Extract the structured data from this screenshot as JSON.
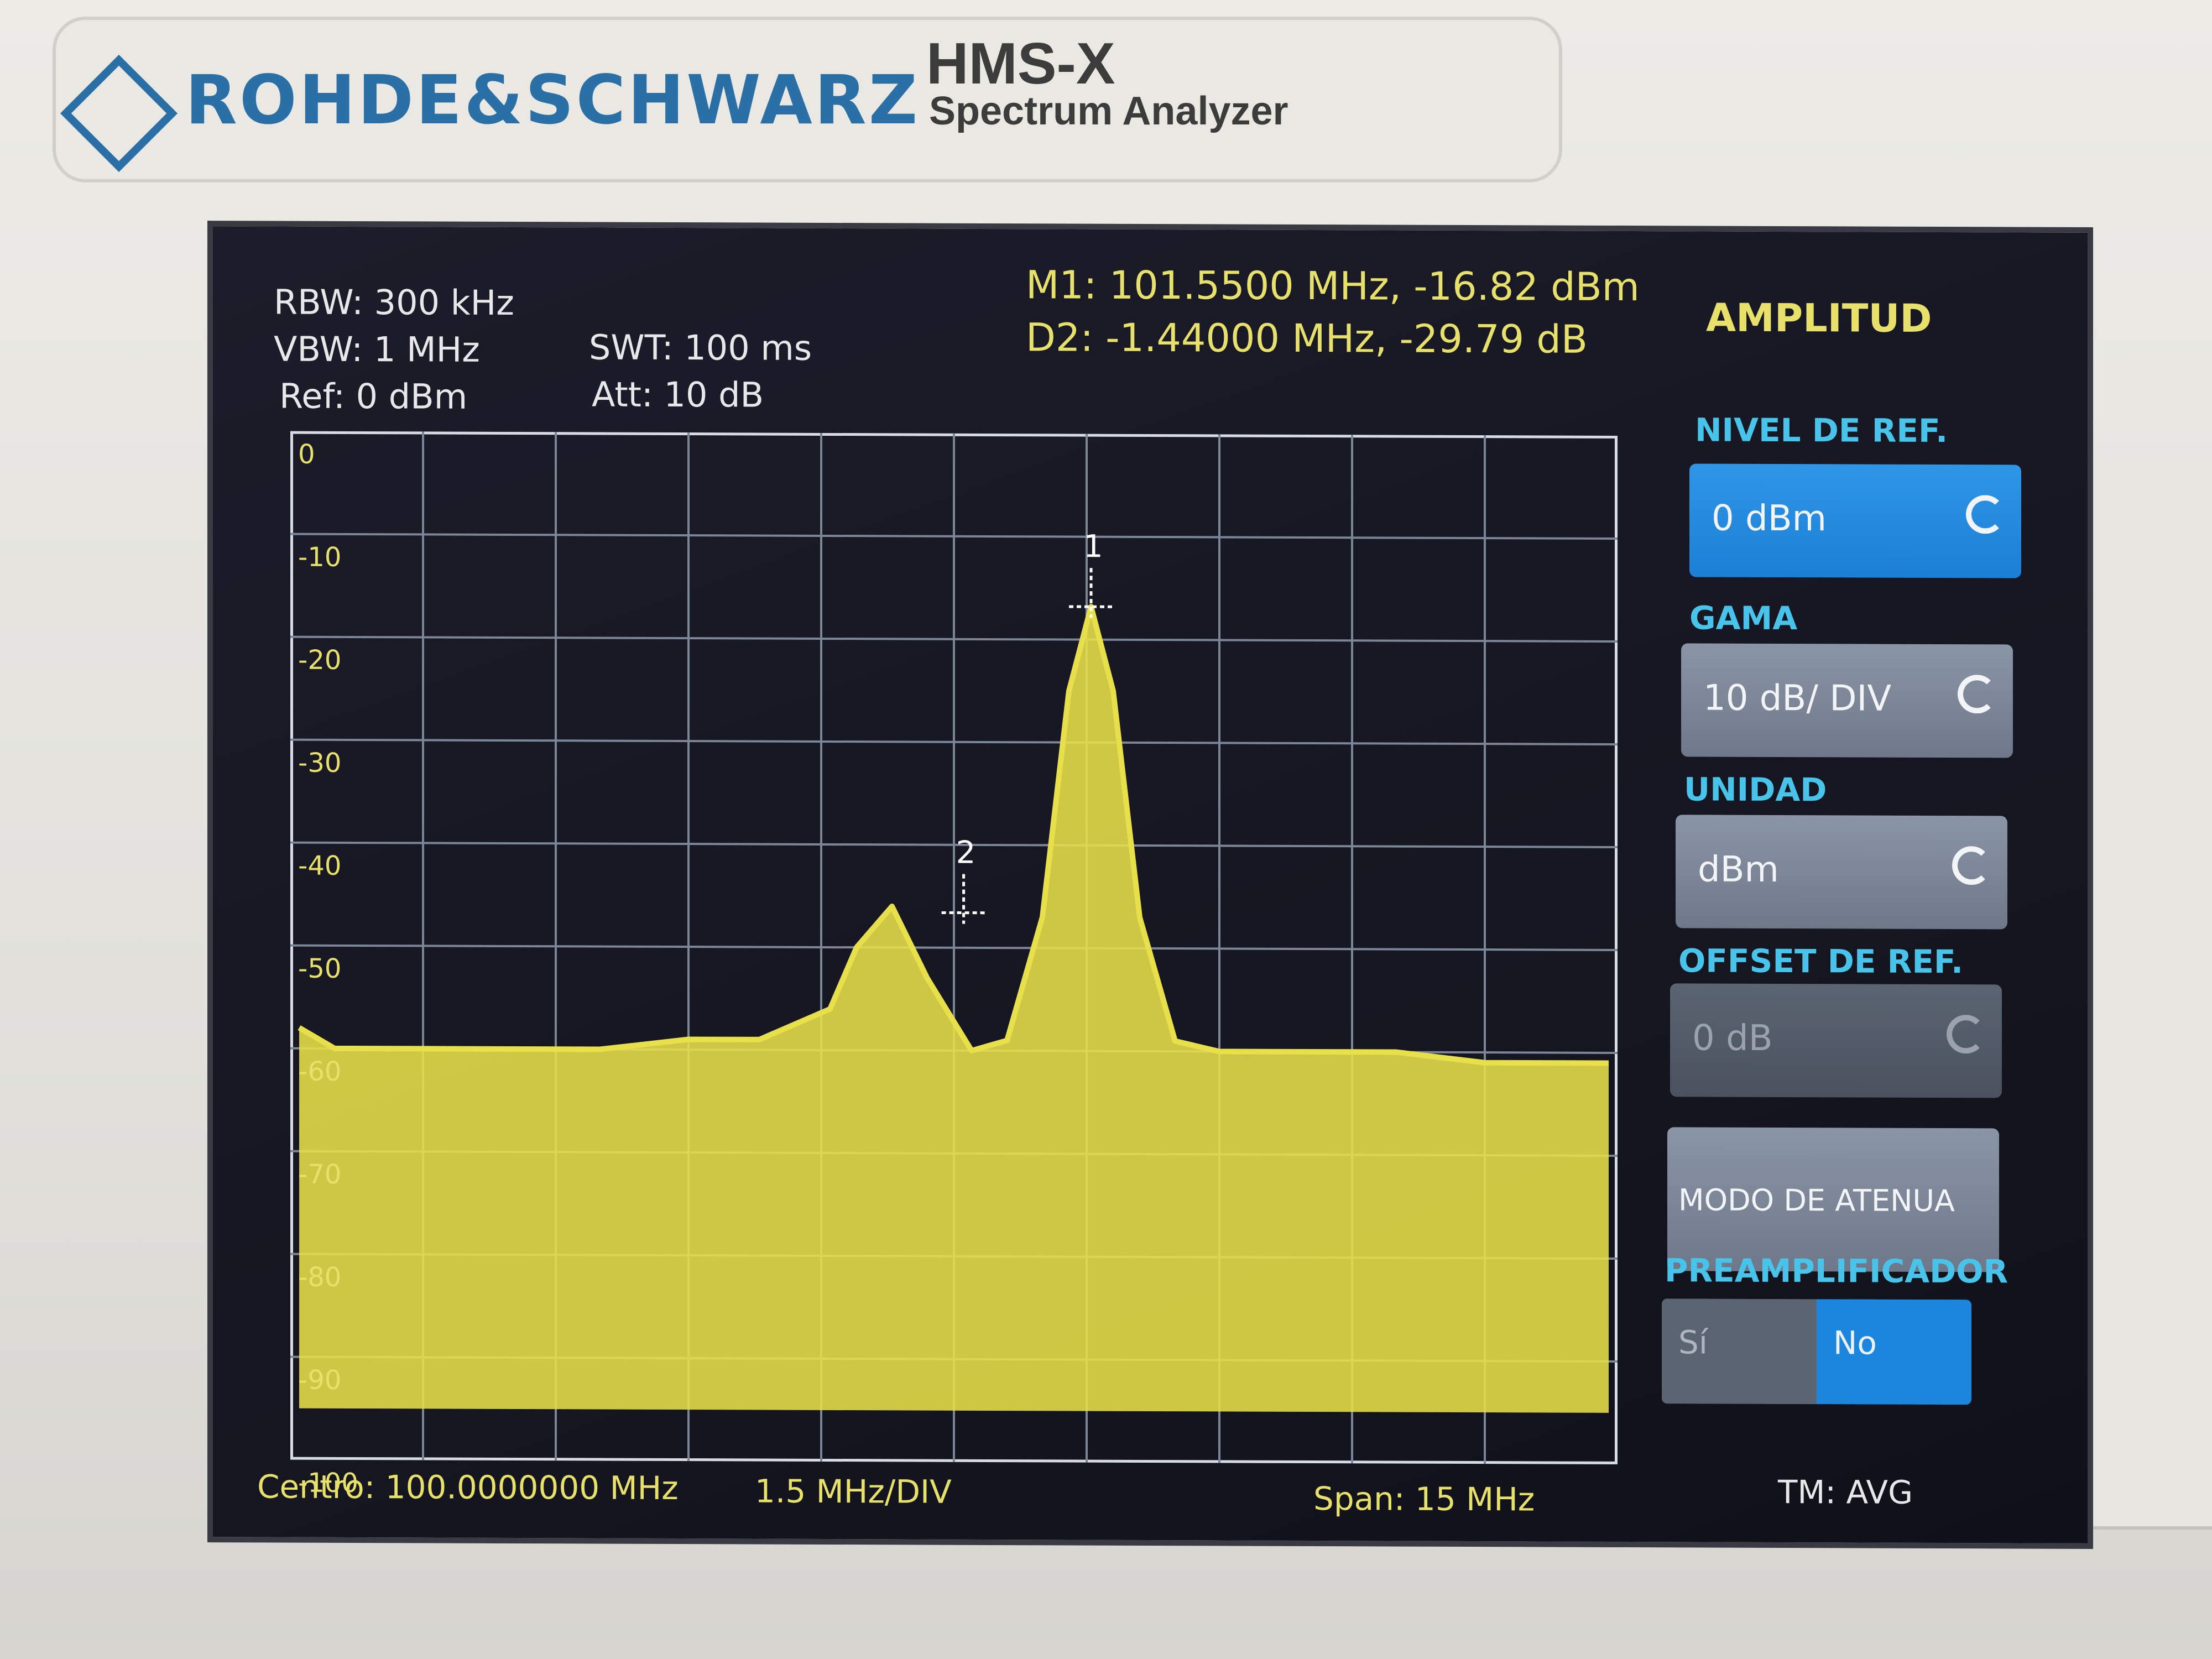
{
  "device": {
    "brand": "ROHDE&SCHWARZ",
    "model": "HMS-X",
    "subtitle": "Spectrum Analyzer"
  },
  "settings": {
    "rbw": "RBW: 300 kHz",
    "vbw": "VBW: 1 MHz",
    "ref": "Ref: 0 dBm",
    "swt": "SWT: 100 ms",
    "att": "Att: 10 dB"
  },
  "markers": {
    "m1": "M1: 101.5500 MHz, -16.82 dBm",
    "d2": "D2: -1.44000 MHz, -29.79 dB",
    "m1_label": "1",
    "d2_label": "2"
  },
  "menu": {
    "title": "AMPLITUD",
    "ref_level_label": "NIVEL DE REF.",
    "ref_level_value": "0 dBm",
    "range_label": "GAMA",
    "range_value": "10 dB/ DIV",
    "unit_label": "UNIDAD",
    "unit_value": "dBm",
    "offset_label": "OFFSET DE REF.",
    "offset_value": "0 dB",
    "atten_mode_label": "MODO DE ATENUA",
    "preamp_label": "PREAMPLIFICADOR",
    "preamp_on": "Sí",
    "preamp_off": "No"
  },
  "footer": {
    "center": "Centro: 100.0000000 MHz",
    "per_div": "1.5 MHz/DIV",
    "span": "Span: 15 MHz",
    "trace_mode": "TM: AVG"
  },
  "colors": {
    "trace": "#e8e04a",
    "grid": "#7d8696",
    "accent": "#1c86dc",
    "label": "#48c4ea"
  },
  "chart_data": {
    "type": "line",
    "xlabel": "",
    "ylabel": "",
    "y_ticks": [
      "0",
      "-10",
      "-20",
      "-30",
      "-40",
      "-50",
      "-60",
      "-70",
      "-80",
      "-90",
      "-100"
    ],
    "xlim": [
      92.5,
      107.5
    ],
    "ylim": [
      -100,
      0
    ],
    "grid": true,
    "series": [
      {
        "x": [
          92.6,
          93.0,
          94.0,
          95.0,
          96.0,
          97.0,
          97.8,
          98.6,
          98.9,
          99.3,
          99.7,
          100.2,
          100.6,
          101.0,
          101.3,
          101.55,
          101.8,
          102.1,
          102.5,
          103.0,
          104.0,
          105.0,
          106.0,
          107.0,
          107.4
        ],
        "y": [
          -58,
          -60,
          -60,
          -60,
          -60,
          -59,
          -59,
          -56,
          -50,
          -46,
          -53,
          -60,
          -59,
          -47,
          -25,
          -16.8,
          -25,
          -47,
          -59,
          -60,
          -60,
          -60,
          -61,
          -61,
          -61
        ]
      }
    ]
  }
}
